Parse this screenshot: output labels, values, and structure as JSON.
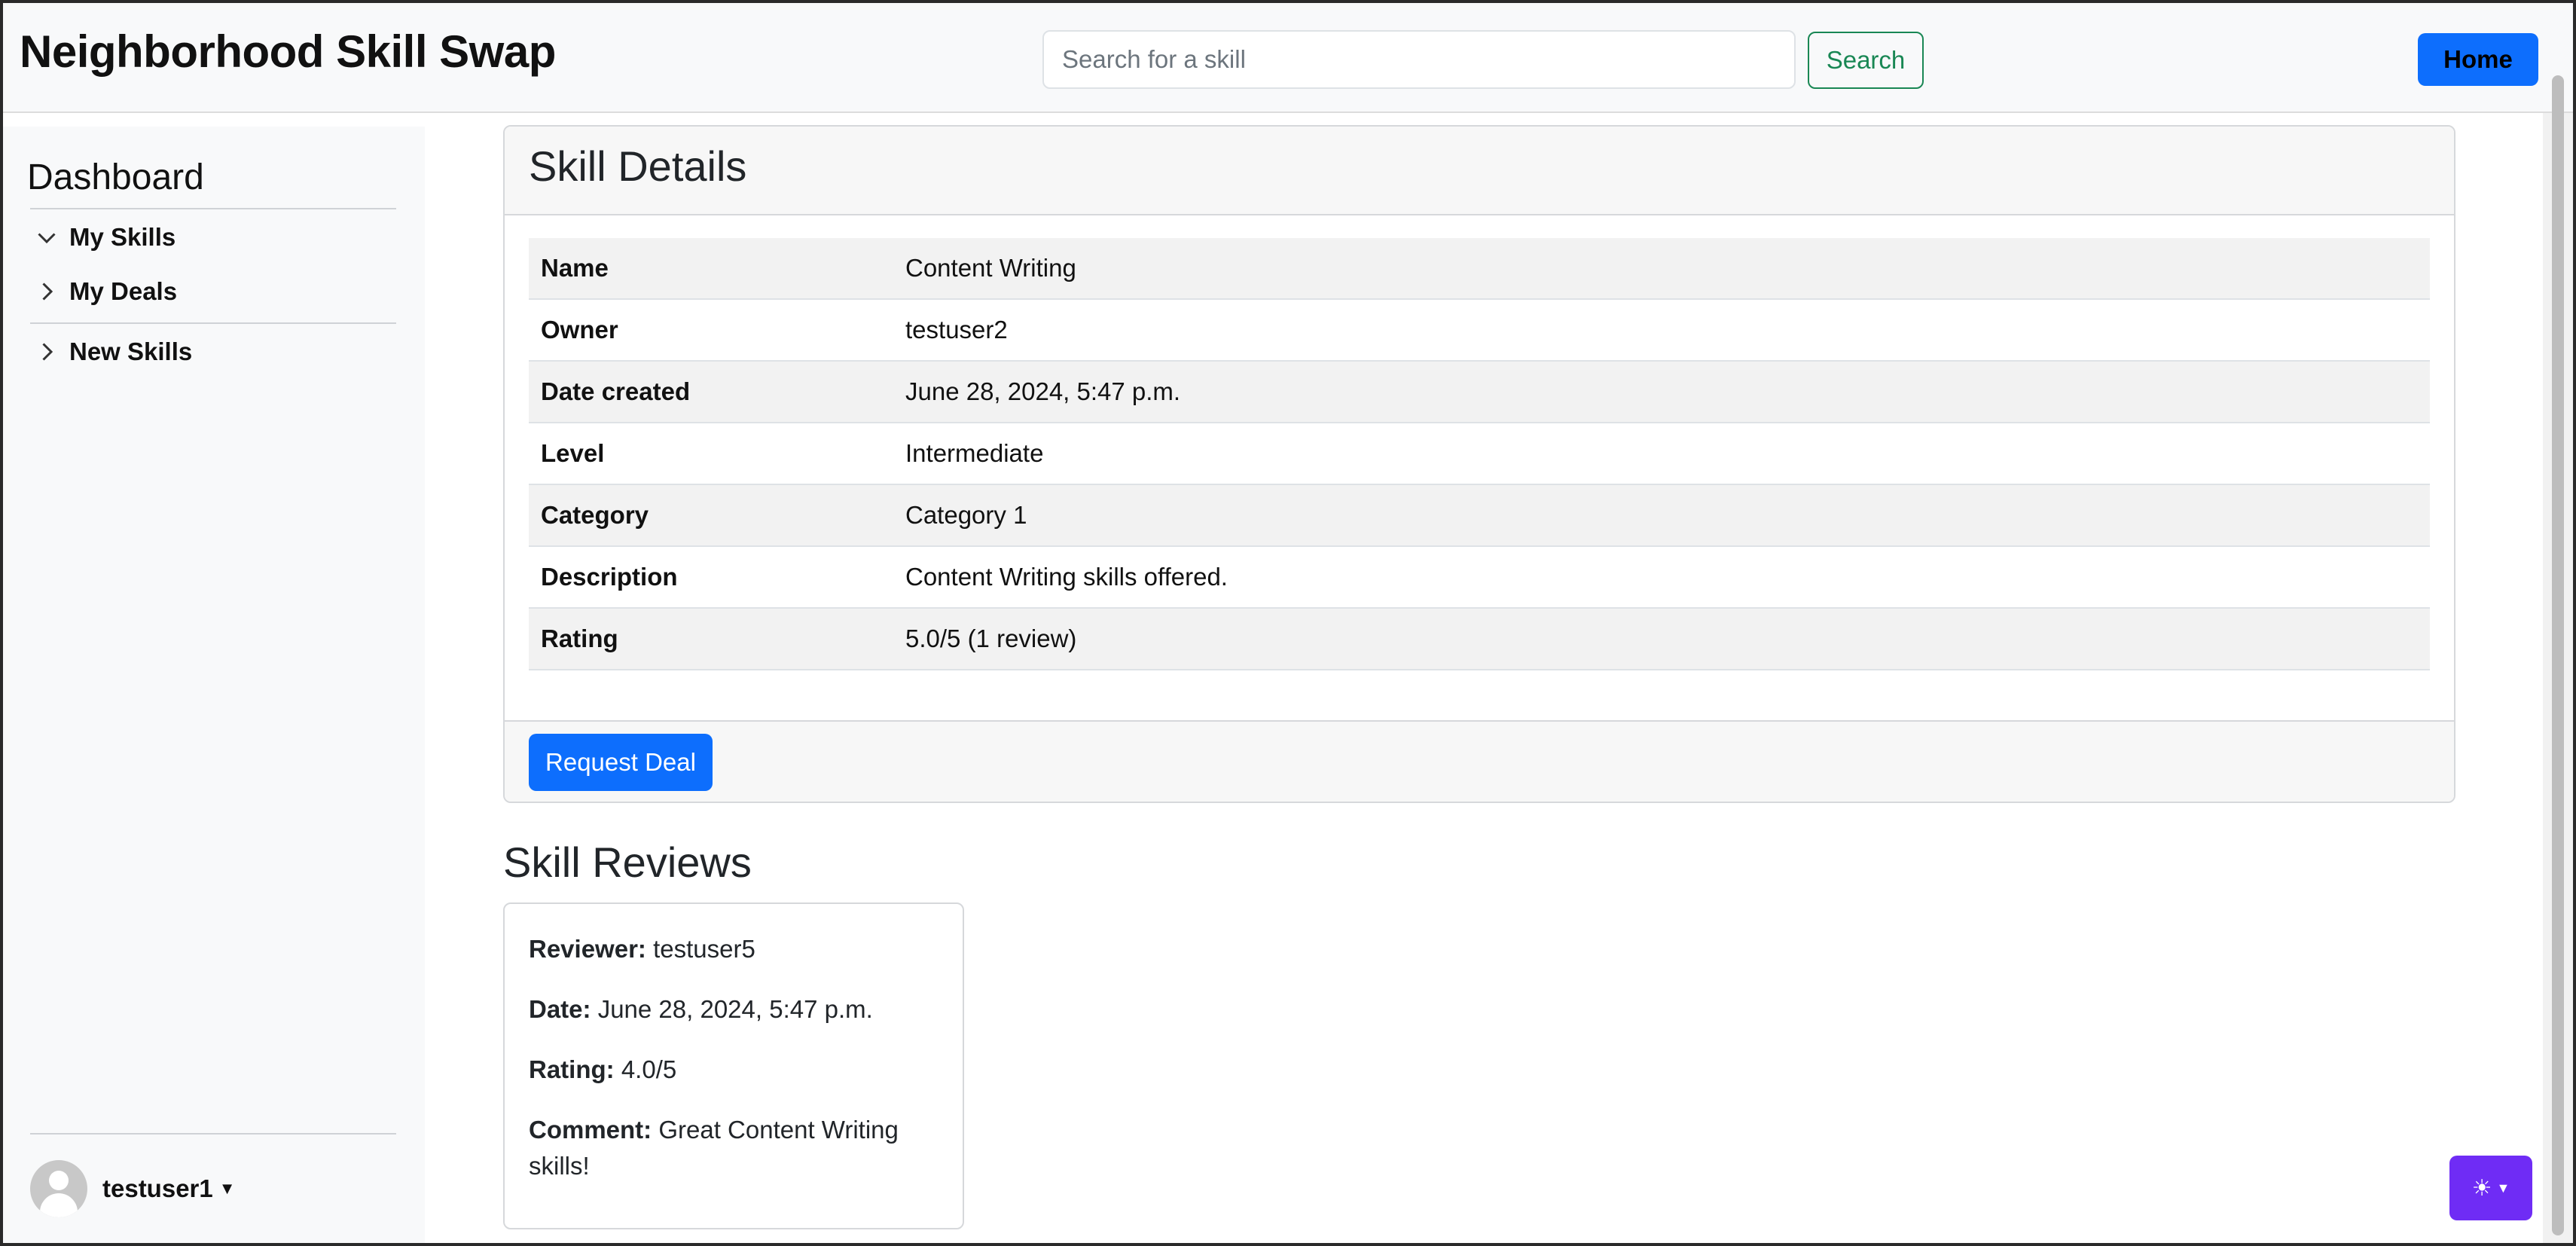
{
  "header": {
    "brand": "Neighborhood Skill Swap",
    "search_placeholder": "Search for a skill",
    "search_label": "Search",
    "home_label": "Home"
  },
  "sidebar": {
    "title": "Dashboard",
    "items": [
      {
        "label": "My Skills",
        "icon": "chevron-down-icon"
      },
      {
        "label": "My Deals",
        "icon": "chevron-right-icon"
      },
      {
        "label": "New Skills",
        "icon": "chevron-right-icon"
      }
    ],
    "user": {
      "name": "testuser1"
    }
  },
  "skill": {
    "header": "Skill Details",
    "rows": [
      {
        "key": "Name",
        "value": "Content Writing"
      },
      {
        "key": "Owner",
        "value": "testuser2"
      },
      {
        "key": "Date created",
        "value": "June 28, 2024, 5:47 p.m."
      },
      {
        "key": "Level",
        "value": "Intermediate"
      },
      {
        "key": "Category",
        "value": "Category 1"
      },
      {
        "key": "Description",
        "value": "Content Writing skills offered."
      },
      {
        "key": "Rating",
        "value": "5.0/5 (1 review)"
      }
    ],
    "request_label": "Request Deal"
  },
  "reviews": {
    "title": "Skill Reviews",
    "items": [
      {
        "reviewer_label": "Reviewer:",
        "reviewer": "testuser5",
        "date_label": "Date:",
        "date": "June 28, 2024, 5:47 p.m.",
        "rating_label": "Rating:",
        "rating": "4.0/5",
        "comment_label": "Comment:",
        "comment": "Great Content Writing skills!"
      }
    ]
  },
  "theme": {
    "icon": "sun-icon",
    "accent": "#6f2cf5"
  }
}
